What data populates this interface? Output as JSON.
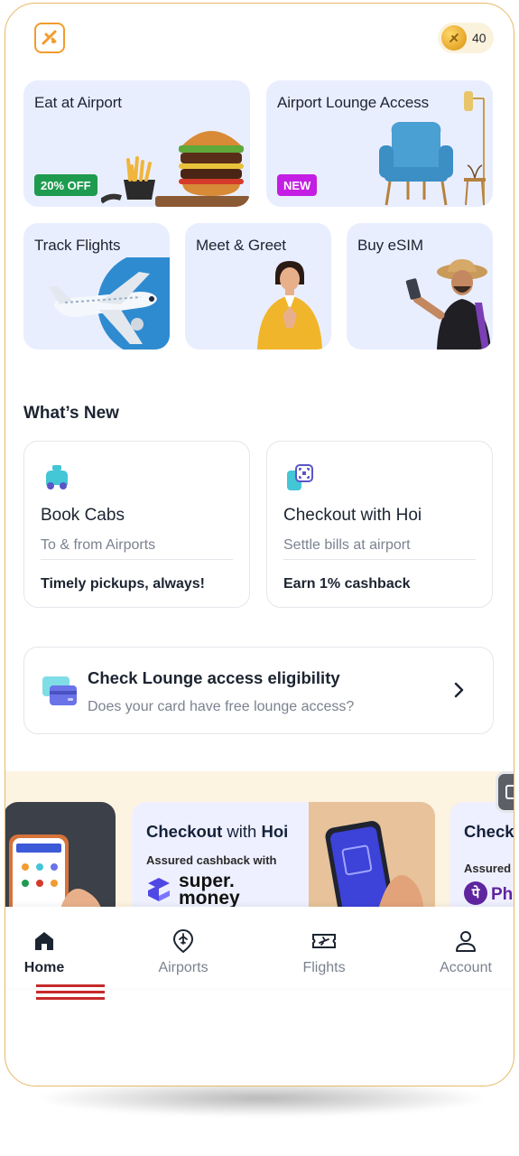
{
  "header": {
    "logo_icon": "hoi-logo-icon",
    "coins": "40"
  },
  "services": [
    {
      "title": "Eat at Airport",
      "badge": "20% OFF",
      "badge_color": "#1e9b4f"
    },
    {
      "title": "Airport Lounge Access",
      "badge": "NEW",
      "badge_color": "#c41de3"
    },
    {
      "title": "Track Flights"
    },
    {
      "title": "Meet & Greet"
    },
    {
      "title": "Buy eSIM"
    }
  ],
  "whats_new": {
    "title": "What’s New",
    "items": [
      {
        "title": "Book Cabs",
        "subtitle": "To & from Airports",
        "footer": "Timely pickups, always!",
        "icon": "cab-icon"
      },
      {
        "title": "Checkout with Hoi",
        "subtitle": "Settle bills at airport",
        "footer": "Earn 1% cashback",
        "icon": "scan-pay-icon"
      }
    ]
  },
  "eligibility": {
    "title": "Check Lounge access eligibility",
    "subtitle": "Does your card have free lounge access?"
  },
  "promos": {
    "main": {
      "title_prefix": "Checkout",
      "title_middle": " with ",
      "title_brand": "Hoi",
      "subtitle": "Assured cashback with",
      "brand_line1": "super.",
      "brand_line2": "money"
    },
    "next": {
      "title": "Check",
      "subtitle": "Assured c",
      "brand": "Ph"
    }
  },
  "bottom_nav": [
    {
      "label": "Home",
      "icon": "home-icon",
      "active": true
    },
    {
      "label": "Airports",
      "icon": "airport-pin-icon",
      "active": false
    },
    {
      "label": "Flights",
      "icon": "ticket-icon",
      "active": false
    },
    {
      "label": "Account",
      "icon": "account-icon",
      "active": false
    }
  ],
  "colors": {
    "accent": "#f29b2f",
    "card_bg": "#e9eeff",
    "navy": "#1c2431"
  }
}
